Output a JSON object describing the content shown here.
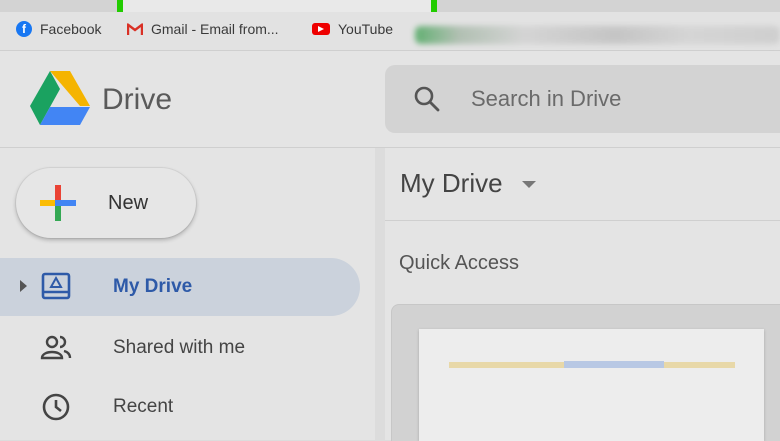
{
  "browser": {
    "bookmarks": [
      {
        "label": "Facebook",
        "icon": "facebook-icon"
      },
      {
        "label": "Gmail - Email from...",
        "icon": "gmail-icon"
      },
      {
        "label": "YouTube",
        "icon": "youtube-icon"
      }
    ]
  },
  "header": {
    "brand": "Drive",
    "search_placeholder": "Search in Drive"
  },
  "sidebar": {
    "new_label": "New",
    "items": [
      {
        "label": "My Drive",
        "icon": "my-drive-icon",
        "active": true
      },
      {
        "label": "Shared with me",
        "icon": "people-icon",
        "active": false
      },
      {
        "label": "Recent",
        "icon": "clock-icon",
        "active": false
      }
    ]
  },
  "main": {
    "title": "My Drive",
    "quick_access_label": "Quick Access"
  },
  "colors": {
    "highlight": "#22cc00",
    "active_nav": "#2e5aa8"
  }
}
